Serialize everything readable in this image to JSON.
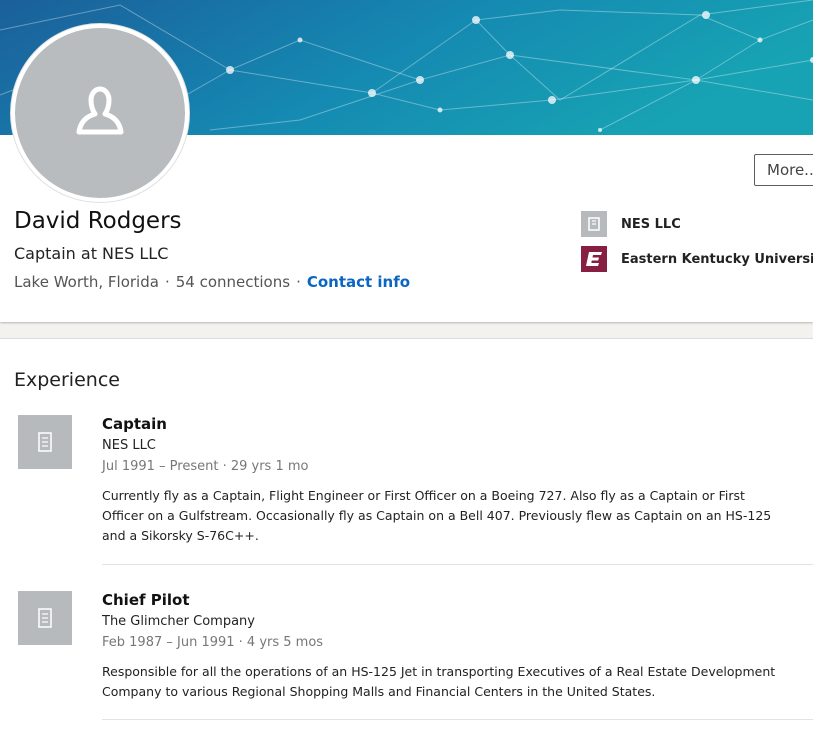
{
  "profile": {
    "name": "David Rodgers",
    "headline": "Captain at NES LLC",
    "location": "Lake Worth, Florida",
    "separator": "·",
    "connections": "54 connections",
    "contact_label": "Contact info",
    "more_label": "More..."
  },
  "organizations": [
    {
      "name": "NES LLC",
      "logo": "building-icon"
    },
    {
      "name": "Eastern Kentucky University",
      "logo": "eku-logo"
    }
  ],
  "experience": {
    "title": "Experience",
    "items": [
      {
        "title": "Captain",
        "company": "NES LLC",
        "dates": "Jul 1991 – Present · 29 yrs 1 mo",
        "description": "Currently fly as a Captain, Flight Engineer or First Officer on a Boeing 727. Also fly as a Captain or First Officer on a Gulfstream. Occasionally fly as Captain on a Bell 407. Previously flew as Captain on an HS-125 and a Sikorsky S-76C++."
      },
      {
        "title": "Chief Pilot",
        "company": "The Glimcher Company",
        "dates": "Feb 1987 – Jun 1991 · 4 yrs 5 mos",
        "description": "Responsible for all the operations of an HS-125 Jet in transporting Executives of a Real Estate Development Company to various Regional Shopping Malls and Financial Centers in the United States."
      }
    ]
  },
  "colors": {
    "link": "#0a66c2",
    "banner_left": "#1b5f9a",
    "banner_right": "#17a3b3",
    "placeholder_gray": "#b7babd",
    "eku_maroon": "#861f41"
  }
}
